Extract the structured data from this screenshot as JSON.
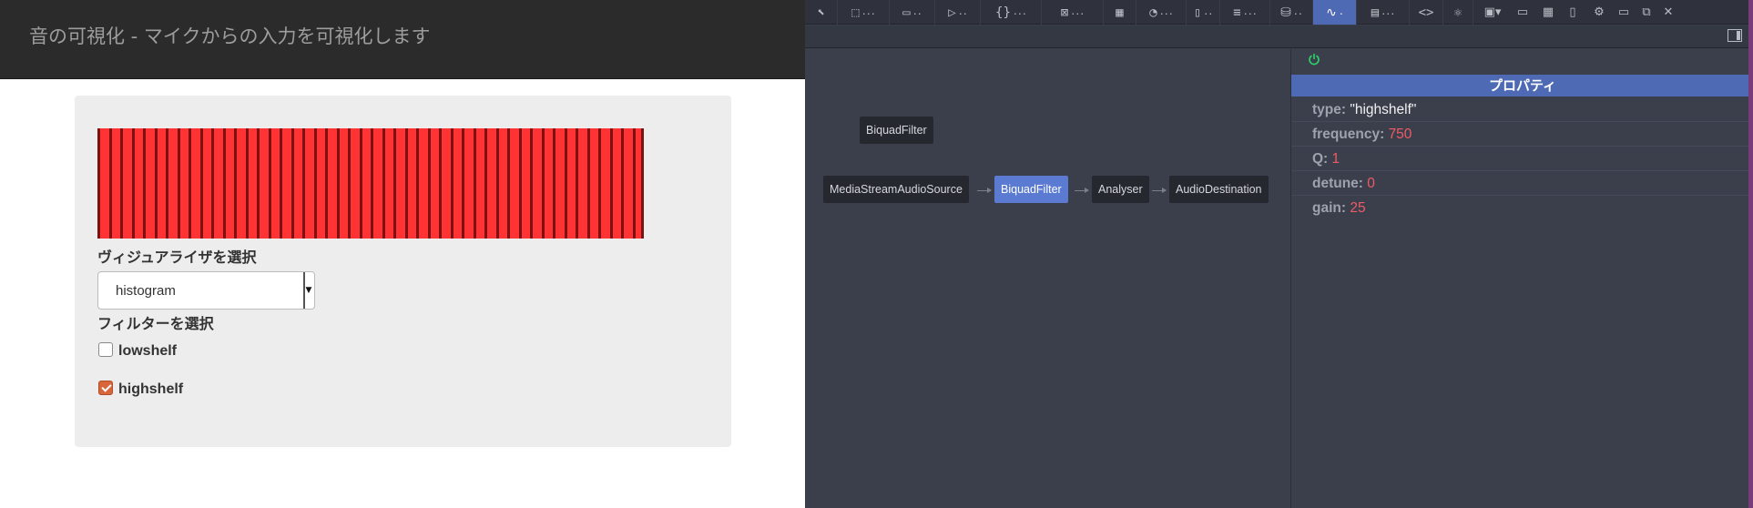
{
  "app": {
    "title": "音の可視化 - マイクからの入力を可視化します"
  },
  "visualizer": {
    "bar_count": 48,
    "bar_color": "#ff3333",
    "divider_color": "#7d1111"
  },
  "controls": {
    "visualizer_label": "ヴィジュアライザを選択",
    "visualizer_selected": "histogram",
    "filter_label": "フィルターを選択",
    "filters": [
      {
        "label": "lowshelf",
        "checked": false
      },
      {
        "label": "highshelf",
        "checked": true
      }
    ]
  },
  "devtools": {
    "tabs": [
      {
        "icon": "inspector-icon",
        "glyph": "⬚",
        "active": false
      },
      {
        "icon": "console-icon",
        "glyph": "▭",
        "active": false
      },
      {
        "icon": "debugger-icon",
        "glyph": "▷",
        "active": false
      },
      {
        "icon": "style-editor-icon",
        "glyph": "⌂",
        "active": false
      },
      {
        "icon": "javascript-icon",
        "glyph": "{}",
        "active": false
      },
      {
        "icon": "canvas-icon",
        "glyph": "⊠",
        "active": false
      },
      {
        "icon": "memory-icon",
        "glyph": "▦",
        "active": false
      },
      {
        "icon": "performance-icon",
        "glyph": "◔",
        "active": false
      },
      {
        "icon": "responsive-icon",
        "glyph": "▯",
        "active": false
      },
      {
        "icon": "network-icon",
        "glyph": "≡",
        "active": false
      },
      {
        "icon": "storage-icon",
        "glyph": "⛁",
        "active": false
      },
      {
        "icon": "webaudio-icon",
        "glyph": "∿",
        "active": true
      },
      {
        "icon": "accessibility-icon",
        "glyph": "▤",
        "active": false
      },
      {
        "icon": "code-icon",
        "glyph": "<>",
        "active": false
      },
      {
        "icon": "react-icon",
        "glyph": "⚛",
        "active": false
      }
    ],
    "graph_nodes": [
      {
        "label": "BiquadFilter",
        "selected": false
      },
      {
        "label": "MediaStreamAudioSource",
        "selected": false
      },
      {
        "label": "BiquadFilter",
        "selected": true
      },
      {
        "label": "Analyser",
        "selected": false
      },
      {
        "label": "AudioDestination",
        "selected": false
      }
    ],
    "properties_header": "プロパティ",
    "properties": [
      {
        "key": "type:",
        "value": "\"highshelf\"",
        "kind": "string"
      },
      {
        "key": "frequency:",
        "value": "750",
        "kind": "number"
      },
      {
        "key": "Q:",
        "value": "1",
        "kind": "number"
      },
      {
        "key": "detune:",
        "value": "0",
        "kind": "number"
      },
      {
        "key": "gain:",
        "value": "25",
        "kind": "number"
      }
    ],
    "accent_color": "#4f6ab4",
    "number_color": "#ee5a67"
  }
}
